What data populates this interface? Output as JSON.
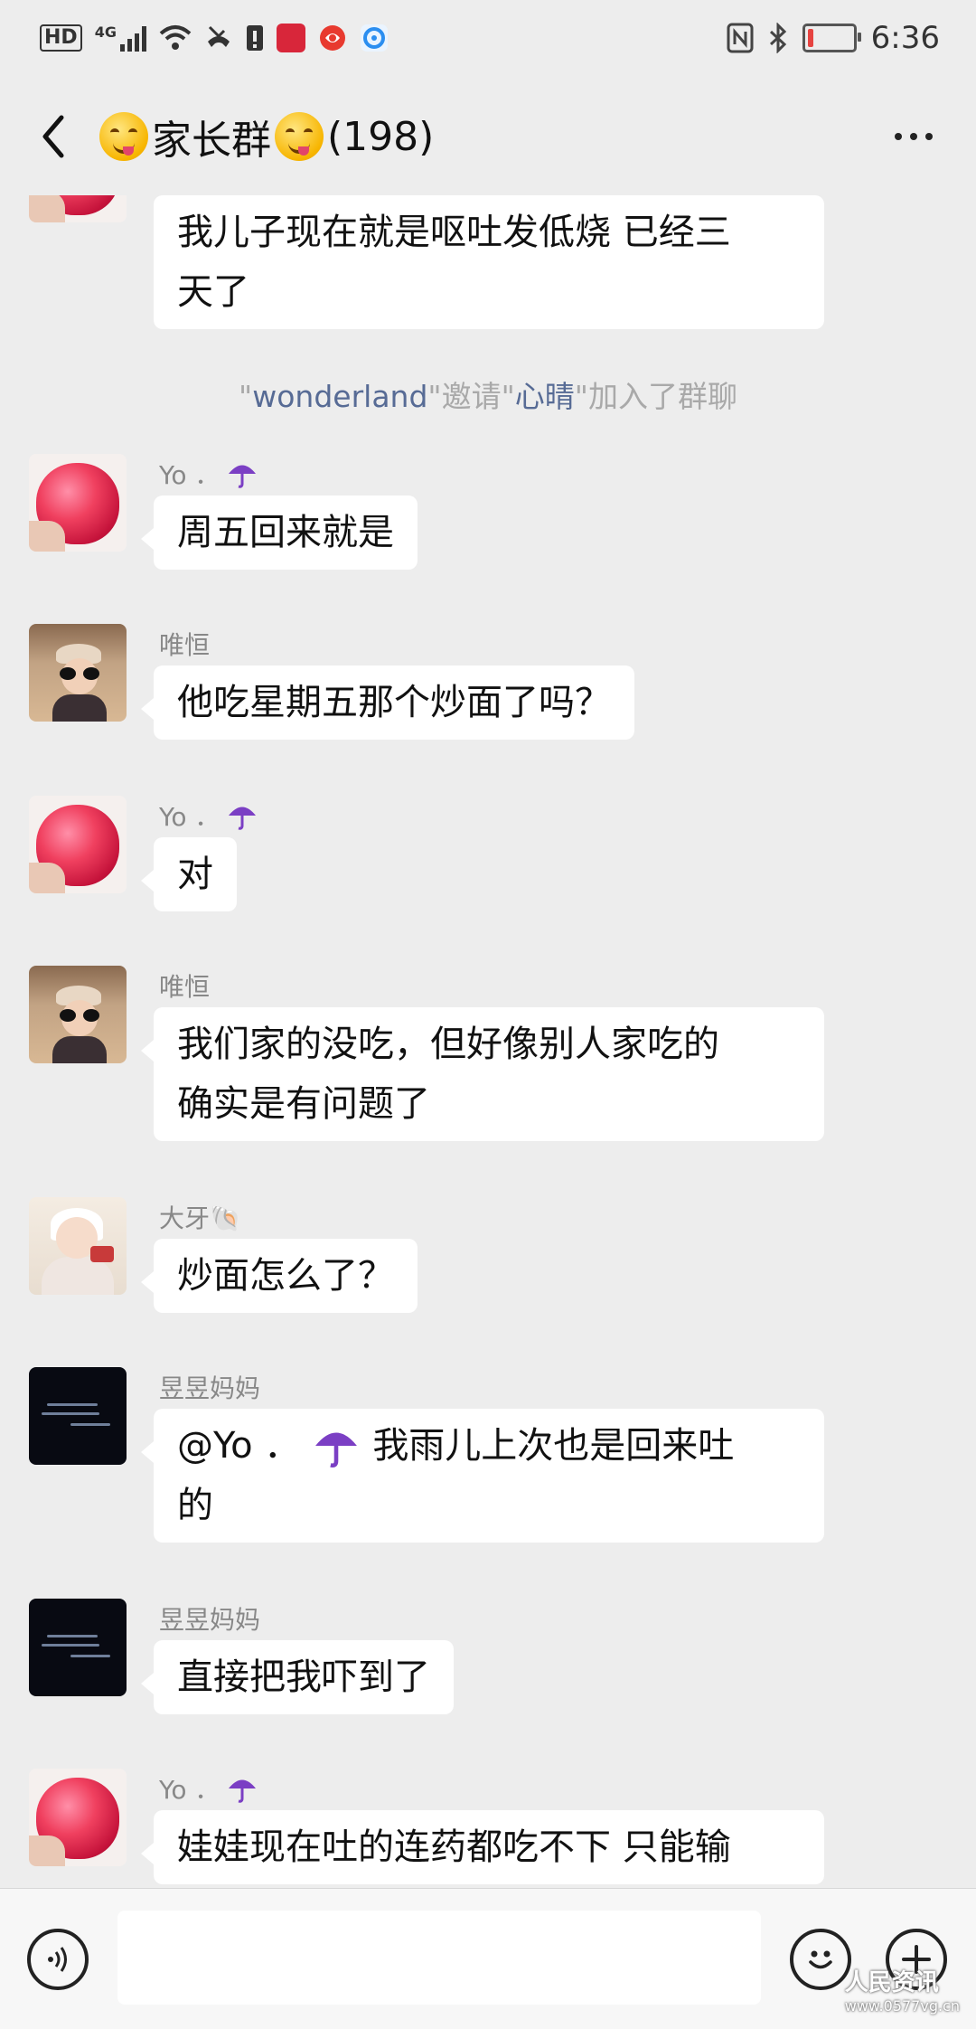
{
  "status_bar": {
    "hd": "HD",
    "network": "4G",
    "time": "6:36",
    "battery_level": 0.12,
    "battery_color": "#e64340",
    "icons": [
      "signal-icon",
      "wifi-icon",
      "missed-call-icon",
      "sim-alert-icon",
      "app-icon-1",
      "app-icon-2",
      "app-icon-3",
      "nfc-icon",
      "bluetooth-icon",
      "battery-icon"
    ]
  },
  "header": {
    "title": "家长群",
    "count": "(198)",
    "back_icon": "chevron-left-icon",
    "more_icon": "more-dots-icon",
    "title_emoji": "yum-face-emoji"
  },
  "messages": [
    {
      "type": "text",
      "avatar": "apple",
      "sender": "",
      "lines": [
        "我儿子现在就是呕吐发低烧 已经三",
        "天了"
      ]
    },
    {
      "type": "system",
      "parts": [
        "\"",
        "wonderland",
        "\"邀请\"",
        "心晴",
        "\"加入了群聊"
      ]
    },
    {
      "type": "text",
      "avatar": "apple",
      "sender": "Yo ．",
      "lines": [
        "周五回来就是"
      ]
    },
    {
      "type": "text",
      "avatar": "beach",
      "sender": "唯恒",
      "lines": [
        "他吃星期五那个炒面了吗？"
      ]
    },
    {
      "type": "text",
      "avatar": "apple",
      "sender": "Yo ．",
      "lines": [
        "对"
      ]
    },
    {
      "type": "text",
      "avatar": "beach",
      "sender": "唯恒",
      "lines": [
        "我们家的没吃，但好像别人家吃的",
        "确实是有问题了"
      ]
    },
    {
      "type": "text",
      "avatar": "baby",
      "sender": "大牙🐚",
      "lines": [
        "炒面怎么了？"
      ]
    },
    {
      "type": "text",
      "avatar": "dark",
      "sender": "昱昱妈妈",
      "lines": [
        "@Yo ．",
        "我雨儿上次也是回来吐",
        "的"
      ]
    },
    {
      "type": "text",
      "avatar": "dark",
      "sender": "昱昱妈妈",
      "lines": [
        "直接把我吓到了"
      ]
    },
    {
      "type": "text",
      "avatar": "apple",
      "sender": "Yo ．",
      "lines": [
        "娃娃现在吐的连药都吃不下 只能输"
      ]
    }
  ],
  "input_bar": {
    "voice_icon": "voice-icon",
    "emoji_icon": "emoji-icon",
    "plus_icon": "plus-icon",
    "placeholder": ""
  },
  "watermark": {
    "text": "人民资讯",
    "sub": "www.0577vg.cn"
  },
  "colors": {
    "background": "#ededed",
    "bubble": "#ffffff",
    "link_name": "#576b95",
    "system_text": "#a9a9a9",
    "sender_text": "#888888"
  }
}
